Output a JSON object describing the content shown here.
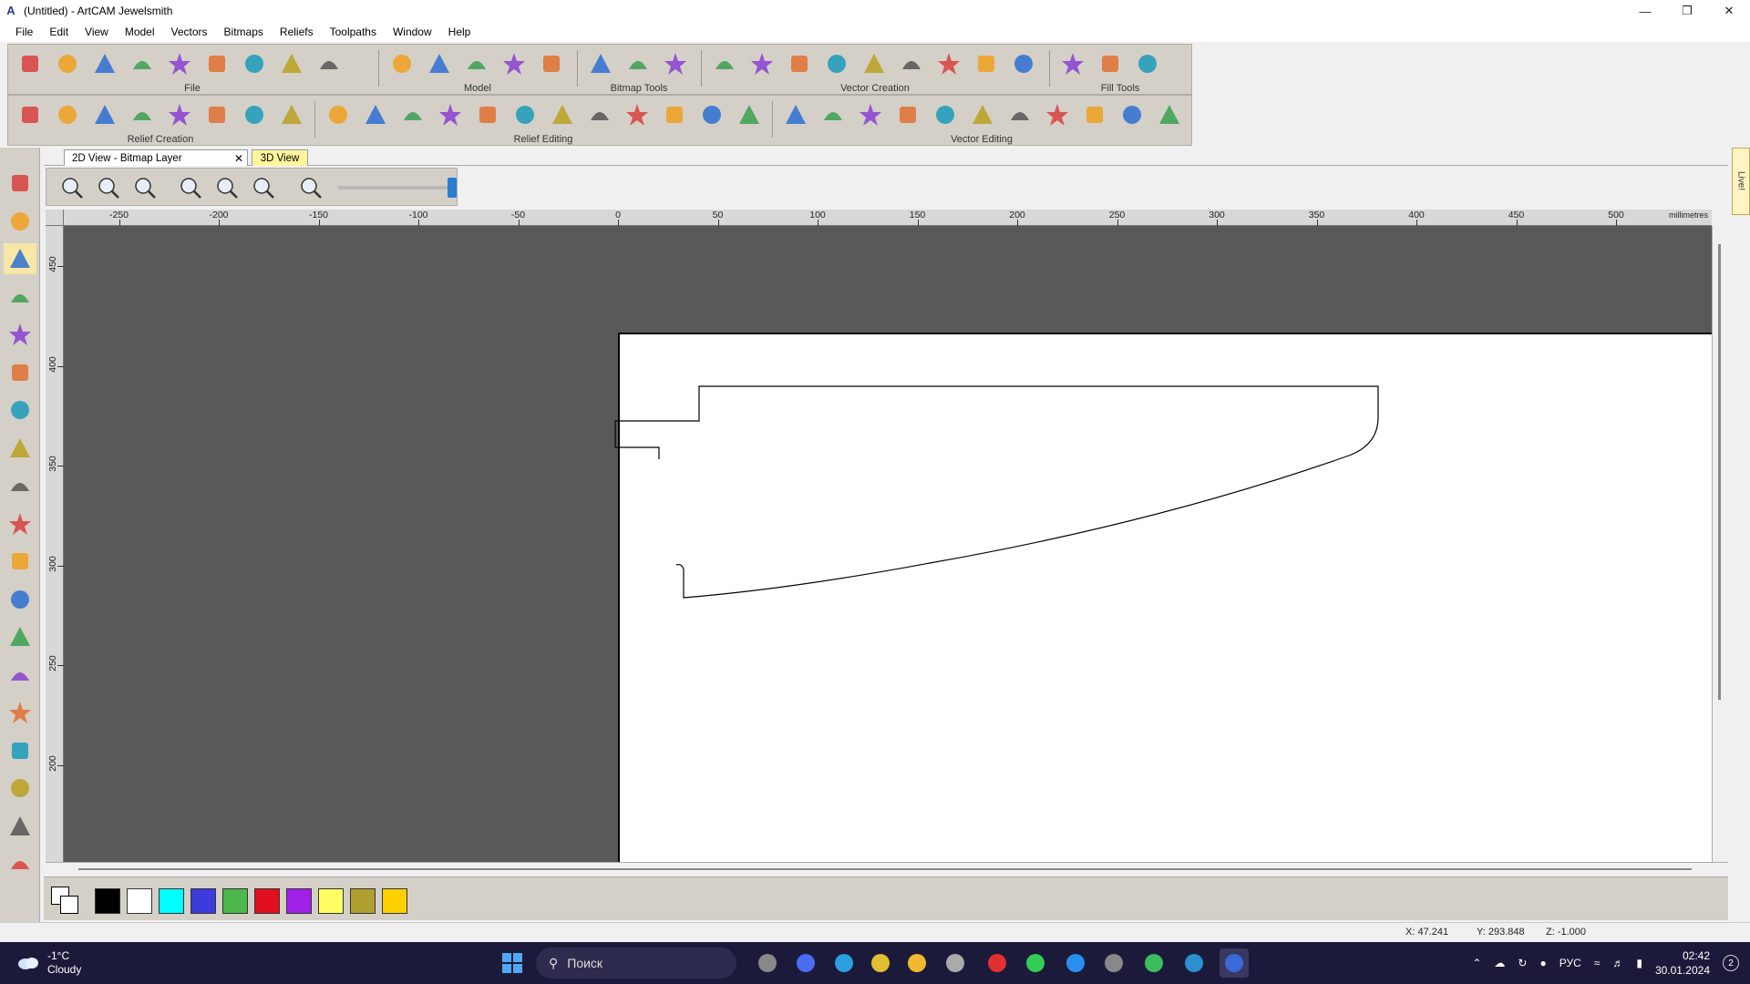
{
  "window": {
    "title": "(Untitled) - ArtCAM Jewelsmith",
    "app_icon": "artcam-logo-icon",
    "controls": [
      "minimize-icon",
      "restore-icon",
      "close-icon"
    ]
  },
  "menu": [
    "File",
    "Edit",
    "View",
    "Model",
    "Vectors",
    "Bitmaps",
    "Reliefs",
    "Toolpaths",
    "Window",
    "Help"
  ],
  "toolbars": {
    "row1": [
      {
        "label": "File",
        "icons": [
          "new-file-icon",
          "open-folder-icon",
          "save-icon",
          "cut-icon",
          "copy-icon",
          "paste-icon",
          "undo-icon",
          "redo-icon",
          "notes-icon"
        ]
      },
      {
        "label": "Model",
        "icons": [
          "model-icon-1",
          "model-icon-2",
          "model-icon-3",
          "model-icon-4",
          "model-icon-5"
        ]
      },
      {
        "label": "Bitmap Tools",
        "icons": [
          "bitmap-tool-icon-1",
          "bitmap-tool-icon-2",
          "bitmap-tool-icon-3"
        ]
      },
      {
        "label": "Vector Creation",
        "icons": [
          "vector-creation-icon-1",
          "vector-creation-icon-2",
          "vector-creation-icon-3",
          "vector-creation-icon-4",
          "vector-creation-icon-5",
          "vector-creation-icon-6",
          "nesting-icon",
          "vector-creation-icon-8",
          "vector-creation-icon-9"
        ]
      },
      {
        "label": "Fill Tools",
        "icons": [
          "fill-tool-icon-1",
          "fill-tool-icon-2",
          "fill-tool-icon-3"
        ]
      }
    ],
    "row2": [
      {
        "label": "Relief Creation",
        "icons": [
          "relief-creation-icon-1",
          "relief-creation-icon-2",
          "relief-creation-icon-3",
          "relief-creation-icon-4",
          "relief-creation-icon-5",
          "relief-creation-icon-6",
          "relief-creation-icon-7",
          "relief-creation-icon-8"
        ]
      },
      {
        "label": "Relief Editing",
        "icons": [
          "relief-editing-icon-1",
          "relief-editing-icon-2",
          "relief-editing-icon-3",
          "relief-editing-icon-4",
          "relief-editing-icon-5",
          "relief-editing-icon-6",
          "relief-editing-icon-7",
          "relief-editing-icon-8",
          "relief-editing-icon-9",
          "relief-editing-icon-10",
          "relief-editing-icon-11",
          "relief-editing-icon-12"
        ]
      },
      {
        "label": "Vector Editing",
        "icons": [
          "vector-editing-icon-1",
          "vector-editing-icon-2",
          "vector-editing-icon-3",
          "vector-editing-icon-4",
          "vector-editing-icon-5",
          "vector-editing-icon-6",
          "vector-editing-icon-7",
          "vector-editing-icon-8",
          "vector-editing-icon-9",
          "vector-editing-icon-10",
          "vector-editing-icon-11"
        ]
      }
    ]
  },
  "tabs": {
    "active": "2D View - Bitmap Layer",
    "other": "3D View"
  },
  "view_toolbar": {
    "icons": [
      "zoom-in-icon",
      "zoom-out-icon",
      "zoom-previous-icon",
      "zoom-fit-icon",
      "zoom-box-icon",
      "zoom-all-icon",
      "settings-icon"
    ],
    "slider_value": 1.0
  },
  "left_tools": [
    "zoom-tool-icon",
    "globe-icon",
    "select-arrow-icon",
    "node-edit-icon",
    "transform-icon",
    "pencil-icon",
    "paint-icon",
    "fill-icon",
    "polyline-icon",
    "rectangle-icon",
    "circle-icon",
    "polygon-icon",
    "arc-icon",
    "text-tool-icon",
    "droplet-icon",
    "brush-icon",
    "pen-icon",
    "eyedropper-icon",
    "eraser-icon"
  ],
  "ruler": {
    "unit": "millimetres",
    "x_ticks": [
      "-250",
      "-200",
      "-150",
      "-100",
      "-50",
      "0",
      "50",
      "100",
      "150",
      "200",
      "250",
      "300",
      "350",
      "400",
      "450",
      "500"
    ],
    "y_ticks": [
      "450",
      "400",
      "350",
      "300",
      "250",
      "200"
    ]
  },
  "palette": {
    "colors": [
      "#000000",
      "#ffffff",
      "#00ffff",
      "#3c3cdc",
      "#4cb84c",
      "#e0101e",
      "#a020e8",
      "#ffff64",
      "#b0a030",
      "#ffd000"
    ]
  },
  "status": {
    "x": "X: 47.241",
    "y": "Y: 293.848",
    "z": "Z: -1.000"
  },
  "live_tab": "Live!",
  "taskbar": {
    "weather_temp": "-1°C",
    "weather_desc": "Cloudy",
    "search_placeholder": "Поиск",
    "apps": [
      "windows-start-icon",
      "explorer-icon",
      "zoom-app-icon",
      "telegram-icon",
      "chrome-icon",
      "folder-icon",
      "database-icon",
      "yandex-icon",
      "pycharm-icon",
      "vscode-icon",
      "store-icon",
      "chrome-2-icon",
      "app-icon",
      "artcam-taskbar-icon"
    ],
    "lang": "РУС",
    "time": "02:42",
    "date": "30.01.2024",
    "notifications": "2"
  }
}
